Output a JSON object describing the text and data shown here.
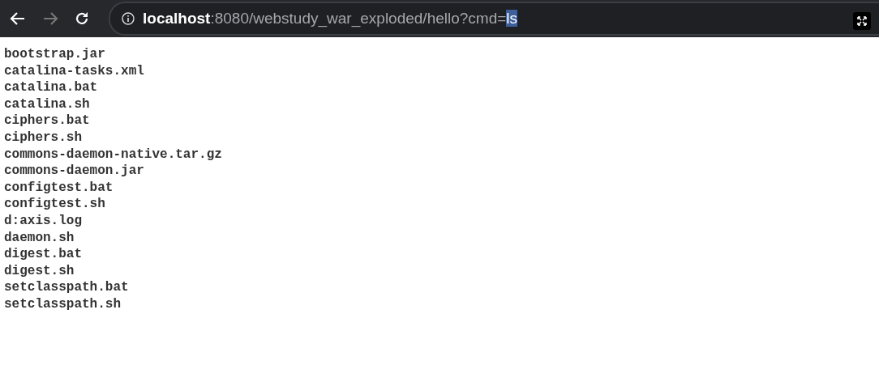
{
  "address_bar": {
    "host": "localhost",
    "path": ":8080/webstudy_war_exploded/hello?cmd=",
    "selected_text": "ls"
  },
  "lines": [
    "bootstrap.jar",
    "catalina-tasks.xml",
    "catalina.bat",
    "catalina.sh",
    "ciphers.bat",
    "ciphers.sh",
    "commons-daemon-native.tar.gz",
    "commons-daemon.jar",
    "configtest.bat",
    "configtest.sh",
    "d:axis.log",
    "daemon.sh",
    "digest.bat",
    "digest.sh",
    "setclasspath.bat",
    "setclasspath.sh"
  ]
}
